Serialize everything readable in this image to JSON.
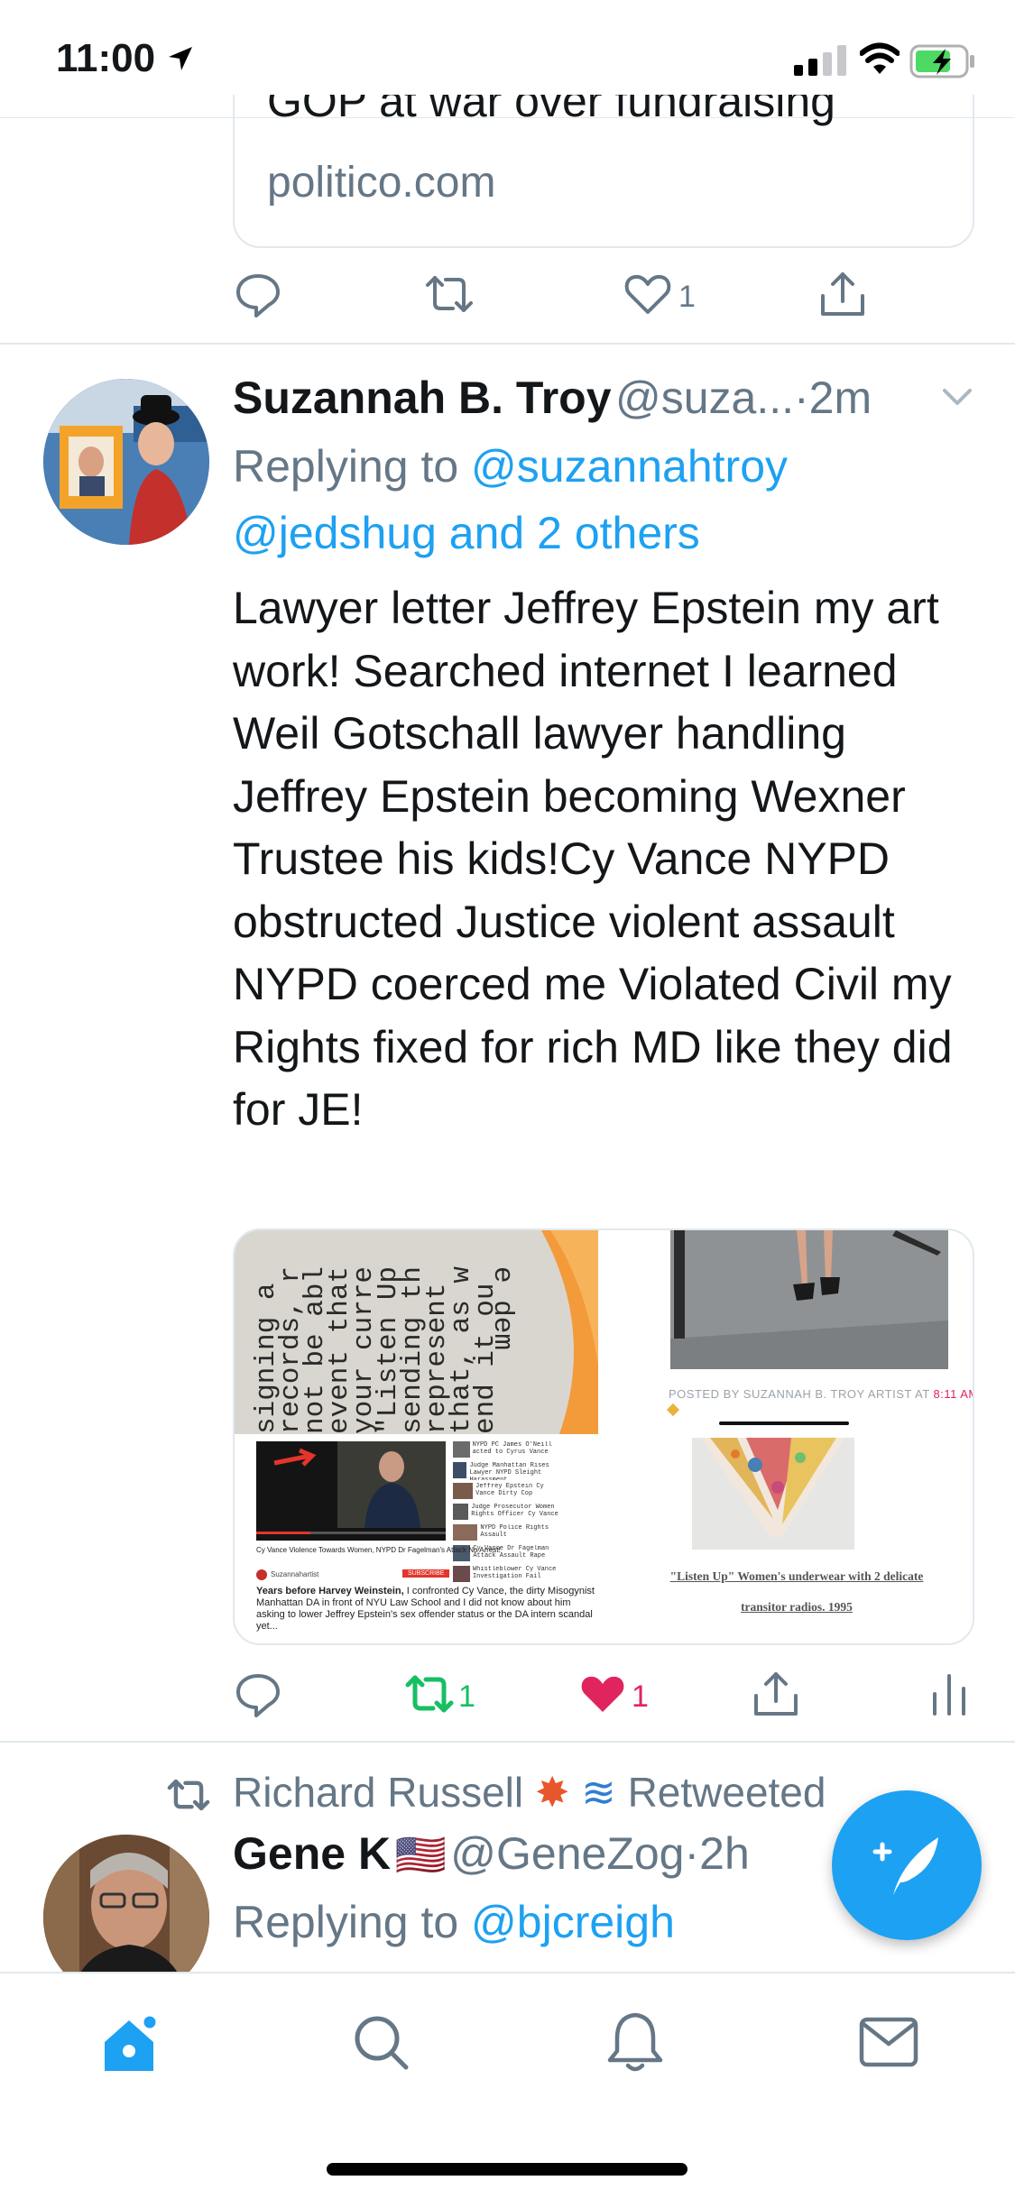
{
  "status_bar": {
    "time": "11:00"
  },
  "prev_tweet": {
    "card_title": "GOP at war over fundraising",
    "card_domain": "politico.com",
    "like_count": "1"
  },
  "tweet": {
    "display_name": "Suzannah B. Troy",
    "handle": "@suza...",
    "time": "·2m",
    "replying_prefix": "Replying to ",
    "replying_user1": "@suzannahtroy",
    "replying_user2": "@jedshug",
    "replying_and": " and ",
    "replying_others": "2 others",
    "text": "Lawyer letter Jeffrey Epstein my art work! Searched internet I learned Weil Gotschall lawyer handling Jeffrey Epstein becoming Wexner Trustee his kids!Cy Vance NYPD obstructed Justice violent assault NYPD coerced me Violated Civil my Rights fixed for rich MD like they did for JE!",
    "retweet_count": "1",
    "like_count": "1",
    "media": {
      "typewriter_lines": [
        "end it ou",
        "that, as w",
        "represent",
        "sending th",
        "\"Listen Up",
        "your curre",
        "event that",
        "not be abl",
        "records, r",
        "signing a"
      ],
      "corner_text": "e dem",
      "blog_caption_prefix": "POSTED BY SUZANNAH B. TROY ARTIST AT ",
      "blog_caption_time": "8:11 AM",
      "video_title": "Cy Vance Violence Towards Women, NYPD Dr Fagelman's Attack No Arrest!",
      "video_channel": "Suzannahartist",
      "video_subscribe": "SUBSCRIBE",
      "video_desc_bold": "Years before Harvey Weinstein,",
      "video_desc": " I confronted Cy Vance, the dirty Misogynist Manhattan DA in front of NYU Law School and I did not know about him asking to lower Jeffrey Epstein's sex offender status or the DA intern scandal yet...",
      "sidebar_items": [
        "NYPD PC James O'Neill acted to Cyrus Vance",
        "Judge Manhattan Rises Lawyer NYPD Sleight Harassment",
        "Jeffrey Epstein Cy Vance Dirty Cop",
        "Judge Prosecutor Women Rights Officer Cy Vance",
        "NYPD Police Rights Assault",
        "Cy Vance Dr Fagelman Attack Assault Rape",
        "Whistleblower Cy Vance Investigation Fail"
      ],
      "art_caption_line1": "\"Listen Up\" Women's underwear with 2 delicate",
      "art_caption_line2": "transitor radios. 1995"
    }
  },
  "next_tweet": {
    "retweeted_by": "Richard Russell",
    "retweeted_suffix": "Retweeted",
    "display_name": "Gene K",
    "flag": "🇺🇸",
    "handle": "@GeneZog",
    "time": "·2h",
    "replying_prefix": "Replying to ",
    "replying_user": "@bjcreigh"
  },
  "colors": {
    "accent": "#1da1f2",
    "retweet": "#17bf63",
    "like": "#e0245e",
    "muted": "#657786"
  },
  "icons": {
    "prev_actions": [
      "reply-icon",
      "retweet-icon",
      "like-icon",
      "share-icon"
    ],
    "tweet_actions": [
      "reply-icon",
      "retweet-icon",
      "like-icon",
      "share-icon",
      "analytics-icon"
    ],
    "tabbar": [
      "home-icon",
      "search-icon",
      "notifications-icon",
      "messages-icon"
    ],
    "fab": "compose-tweet-icon"
  }
}
